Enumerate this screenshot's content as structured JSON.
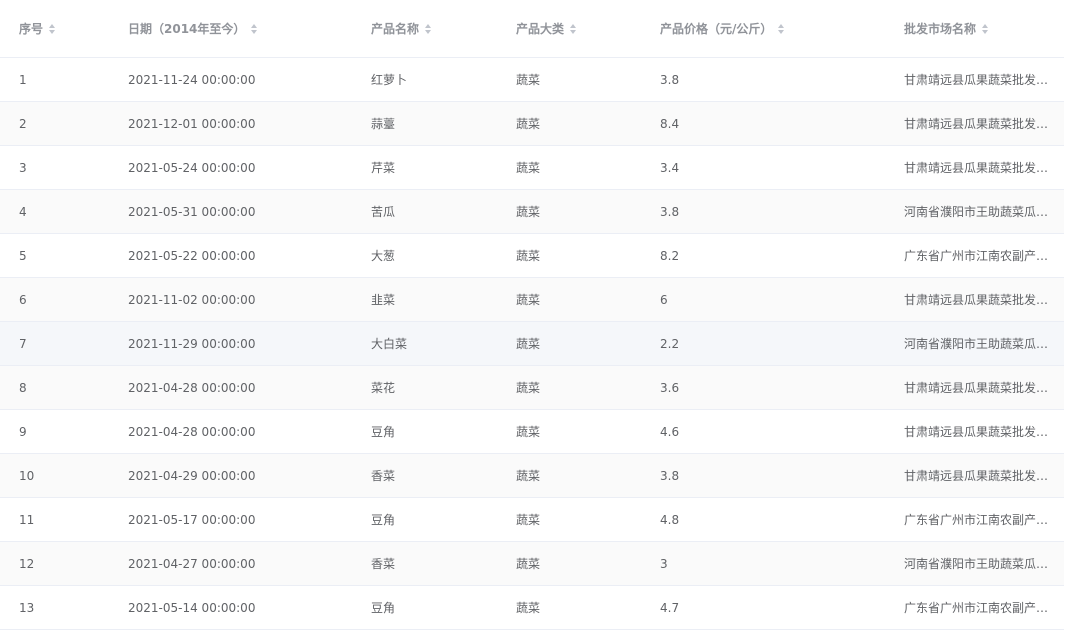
{
  "table": {
    "columns": [
      {
        "key": "id",
        "label": "序号"
      },
      {
        "key": "date",
        "label": "日期（2014年至今）"
      },
      {
        "key": "name",
        "label": "产品名称"
      },
      {
        "key": "category",
        "label": "产品大类"
      },
      {
        "key": "price",
        "label": "产品价格（元/公斤）"
      },
      {
        "key": "market",
        "label": "批发市场名称"
      }
    ],
    "rows": [
      {
        "id": "1",
        "date": "2021-11-24 00:00:00",
        "name": "红萝卜",
        "category": "蔬菜",
        "price": "3.8",
        "market": "甘肃靖远县瓜果蔬菜批发…"
      },
      {
        "id": "2",
        "date": "2021-12-01 00:00:00",
        "name": "蒜薹",
        "category": "蔬菜",
        "price": "8.4",
        "market": "甘肃靖远县瓜果蔬菜批发…"
      },
      {
        "id": "3",
        "date": "2021-05-24 00:00:00",
        "name": "芹菜",
        "category": "蔬菜",
        "price": "3.4",
        "market": "甘肃靖远县瓜果蔬菜批发…"
      },
      {
        "id": "4",
        "date": "2021-05-31 00:00:00",
        "name": "苦瓜",
        "category": "蔬菜",
        "price": "3.8",
        "market": "河南省濮阳市王助蔬菜瓜…"
      },
      {
        "id": "5",
        "date": "2021-05-22 00:00:00",
        "name": "大葱",
        "category": "蔬菜",
        "price": "8.2",
        "market": "广东省广州市江南农副产…"
      },
      {
        "id": "6",
        "date": "2021-11-02 00:00:00",
        "name": "韭菜",
        "category": "蔬菜",
        "price": "6",
        "market": "甘肃靖远县瓜果蔬菜批发…"
      },
      {
        "id": "7",
        "date": "2021-11-29 00:00:00",
        "name": "大白菜",
        "category": "蔬菜",
        "price": "2.2",
        "market": "河南省濮阳市王助蔬菜瓜…"
      },
      {
        "id": "8",
        "date": "2021-04-28 00:00:00",
        "name": "菜花",
        "category": "蔬菜",
        "price": "3.6",
        "market": "甘肃靖远县瓜果蔬菜批发…"
      },
      {
        "id": "9",
        "date": "2021-04-28 00:00:00",
        "name": "豆角",
        "category": "蔬菜",
        "price": "4.6",
        "market": "甘肃靖远县瓜果蔬菜批发…"
      },
      {
        "id": "10",
        "date": "2021-04-29 00:00:00",
        "name": "香菜",
        "category": "蔬菜",
        "price": "3.8",
        "market": "甘肃靖远县瓜果蔬菜批发…"
      },
      {
        "id": "11",
        "date": "2021-05-17 00:00:00",
        "name": "豆角",
        "category": "蔬菜",
        "price": "4.8",
        "market": "广东省广州市江南农副产…"
      },
      {
        "id": "12",
        "date": "2021-04-27 00:00:00",
        "name": "香菜",
        "category": "蔬菜",
        "price": "3",
        "market": "河南省濮阳市王助蔬菜瓜…"
      },
      {
        "id": "13",
        "date": "2021-05-14 00:00:00",
        "name": "豆角",
        "category": "蔬菜",
        "price": "4.7",
        "market": "广东省广州市江南农副产…"
      }
    ],
    "striped_rows": [
      1,
      3,
      5,
      7,
      9,
      11
    ],
    "hovered_row": 6,
    "colors": {
      "header_text": "#909399",
      "cell_text": "#606266",
      "border": "#ebeef5",
      "stripe_bg": "#fafafa",
      "hover_bg": "#f5f7fa",
      "sort_icon": "#c0c4cc"
    },
    "icons": {
      "sort": "sort-caret-icon"
    }
  }
}
